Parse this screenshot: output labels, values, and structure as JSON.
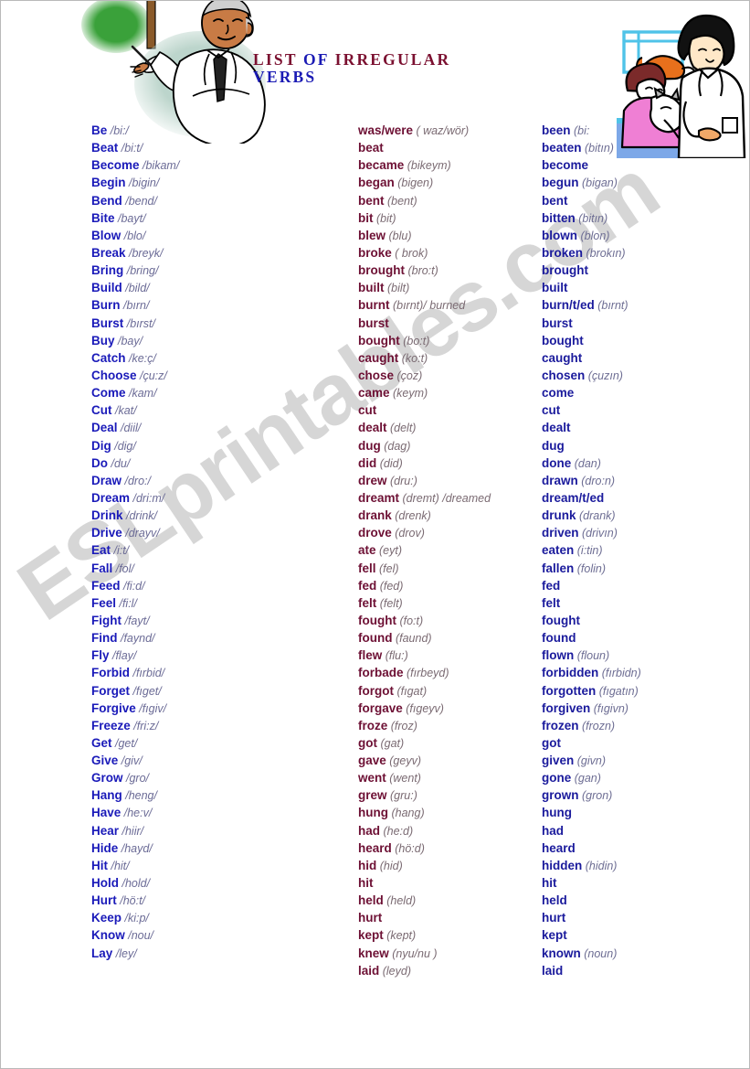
{
  "title": {
    "line1_part1": "LIST ",
    "line1_part2": "OF ",
    "line1_part3": "IRREGULAR",
    "line2": "VERBS"
  },
  "watermark": {
    "text": "ESLprintables.com"
  },
  "colors": {
    "base_word": "#1a1ab9",
    "base_phonetic": "#6b6b96",
    "past_word": "#6d1034",
    "past_phonetic": "#7a6a72",
    "participle_word": "#1a1a9c",
    "participle_phonetic": "#6d6d93",
    "title_red": "#7b1030",
    "title_blue": "#1a1ab4",
    "chalkboard_green": "#3aa13a",
    "border": "#b9b9b9"
  },
  "illustrations": [
    {
      "name": "teacher-pointing-at-chalkboard",
      "description": "Teacher in white coat with pointer at a green chalkboard"
    },
    {
      "name": "veterinarian-with-child-and-pets",
      "description": "Vet in white coat with child holding a cat, dog on table"
    }
  ],
  "columns": {
    "base": [
      {
        "word": "Be",
        "phonetic": "/bi:/"
      },
      {
        "word": "Beat",
        "phonetic": "/bi:t/"
      },
      {
        "word": "Become",
        "phonetic": "/bikam/"
      },
      {
        "word": "Begin",
        "phonetic": "/bigin/"
      },
      {
        "word": "Bend",
        "phonetic": "/bend/"
      },
      {
        "word": "Bite",
        "phonetic": "/bayt/"
      },
      {
        "word": "Blow",
        "phonetic": "/blo/"
      },
      {
        "word": "Break",
        "phonetic": "/breyk/"
      },
      {
        "word": "Bring",
        "phonetic": "/bring/"
      },
      {
        "word": "Build",
        "phonetic": "/bild/"
      },
      {
        "word": "Burn",
        "phonetic": "/bırn/"
      },
      {
        "word": "Burst",
        "phonetic": "/bırst/"
      },
      {
        "word": "Buy",
        "phonetic": "/bay/"
      },
      {
        "word": "Catch",
        "phonetic": "/ke:ç/"
      },
      {
        "word": "Choose",
        "phonetic": "/çu:z/"
      },
      {
        "word": "Come",
        "phonetic": "/kam/"
      },
      {
        "word": "Cut",
        "phonetic": "/kat/"
      },
      {
        "word": "Deal",
        "phonetic": "/diil/"
      },
      {
        "word": "Dig",
        "phonetic": "/dig/"
      },
      {
        "word": "Do",
        "phonetic": "/du/"
      },
      {
        "word": "Draw",
        "phonetic": "/dro:/"
      },
      {
        "word": "Dream",
        "phonetic": "/dri:m/"
      },
      {
        "word": "Drink",
        "phonetic": "/drink/"
      },
      {
        "word": "Drive",
        "phonetic": "/drayv/"
      },
      {
        "word": "Eat",
        "phonetic": "/i:t/"
      },
      {
        "word": "Fall",
        "phonetic": "/fol/"
      },
      {
        "word": "Feed",
        "phonetic": "/fi:d/"
      },
      {
        "word": "Feel",
        "phonetic": "/fi:l/"
      },
      {
        "word": "Fight",
        "phonetic": "/fayt/"
      },
      {
        "word": "Find",
        "phonetic": "/faynd/"
      },
      {
        "word": "Fly",
        "phonetic": "/flay/"
      },
      {
        "word": "Forbid",
        "phonetic": "/fırbid/"
      },
      {
        "word": "Forget",
        "phonetic": "/fıget/"
      },
      {
        "word": "Forgive",
        "phonetic": "/fıgiv/"
      },
      {
        "word": "Freeze",
        "phonetic": "/fri:z/"
      },
      {
        "word": "Get",
        "phonetic": "/get/"
      },
      {
        "word": "Give",
        "phonetic": "/giv/"
      },
      {
        "word": "Grow",
        "phonetic": "/gro/"
      },
      {
        "word": "Hang",
        "phonetic": "/heng/"
      },
      {
        "word": "Have",
        "phonetic": "/he:v/"
      },
      {
        "word": "Hear",
        "phonetic": "/hiir/"
      },
      {
        "word": "Hide",
        "phonetic": "/hayd/"
      },
      {
        "word": "Hit",
        "phonetic": "/hit/"
      },
      {
        "word": "Hold",
        "phonetic": "/hold/"
      },
      {
        "word": "Hurt",
        "phonetic": "/hö:t/"
      },
      {
        "word": "Keep",
        "phonetic": "/ki:p/"
      },
      {
        "word": "Know",
        "phonetic": "/nou/"
      },
      {
        "word": "Lay",
        "phonetic": "/ley/"
      }
    ],
    "past": [
      {
        "word": "was/were",
        "phonetic": "( waz/wör)"
      },
      {
        "word": "beat",
        "phonetic": ""
      },
      {
        "word": "became",
        "phonetic": "(bikeym)"
      },
      {
        "word": "began",
        "phonetic": "(bigen)"
      },
      {
        "word": "bent",
        "phonetic": "(bent)"
      },
      {
        "word": "bit",
        "phonetic": "(bit)"
      },
      {
        "word": "blew",
        "phonetic": "(blu)"
      },
      {
        "word": "broke",
        "phonetic": "( brok)"
      },
      {
        "word": "brought",
        "phonetic": "(bro:t)"
      },
      {
        "word": "built",
        "phonetic": "(bilt)"
      },
      {
        "word": "burnt",
        "phonetic": "(bırnt)/ burned"
      },
      {
        "word": "burst",
        "phonetic": ""
      },
      {
        "word": "bought",
        "phonetic": "(bo:t)"
      },
      {
        "word": "caught",
        "phonetic": "(ko:t)"
      },
      {
        "word": "chose",
        "phonetic": "(çoz)"
      },
      {
        "word": "came",
        "phonetic": "(keym)"
      },
      {
        "word": "cut",
        "phonetic": ""
      },
      {
        "word": "dealt",
        "phonetic": "(delt)"
      },
      {
        "word": "dug",
        "phonetic": "(dag)"
      },
      {
        "word": "did",
        "phonetic": "(did)"
      },
      {
        "word": "drew",
        "phonetic": "(dru:)"
      },
      {
        "word": "dreamt",
        "phonetic": "(dremt) /dreamed"
      },
      {
        "word": "drank",
        "phonetic": "(drenk)"
      },
      {
        "word": "drove",
        "phonetic": "(drov)"
      },
      {
        "word": "ate",
        "phonetic": "(eyt)"
      },
      {
        "word": "fell",
        "phonetic": "(fel)"
      },
      {
        "word": "fed",
        "phonetic": "(fed)"
      },
      {
        "word": "felt",
        "phonetic": "(felt)"
      },
      {
        "word": "fought",
        "phonetic": "(fo:t)"
      },
      {
        "word": "found",
        "phonetic": "(faund)"
      },
      {
        "word": "flew",
        "phonetic": "(flu:)"
      },
      {
        "word": "forbade",
        "phonetic": "(fırbeyd)"
      },
      {
        "word": "forgot",
        "phonetic": "(fıgat)"
      },
      {
        "word": "forgave",
        "phonetic": "(fıgeyv)"
      },
      {
        "word": "froze",
        "phonetic": "(froz)"
      },
      {
        "word": "got",
        "phonetic": "(gat)"
      },
      {
        "word": "gave",
        "phonetic": "(geyv)"
      },
      {
        "word": "went",
        "phonetic": "(went)"
      },
      {
        "word": "grew",
        "phonetic": "(gru:)"
      },
      {
        "word": "hung",
        "phonetic": "(hang)"
      },
      {
        "word": "had",
        "phonetic": "(he:d)"
      },
      {
        "word": "heard",
        "phonetic": "(hö:d)"
      },
      {
        "word": "hid",
        "phonetic": "(hid)"
      },
      {
        "word": "hit",
        "phonetic": ""
      },
      {
        "word": "held",
        "phonetic": "(held)"
      },
      {
        "word": "hurt",
        "phonetic": ""
      },
      {
        "word": "kept",
        "phonetic": "(kept)"
      },
      {
        "word": "knew",
        "phonetic": "(nyu/nu )"
      },
      {
        "word": "laid",
        "phonetic": "(leyd)"
      }
    ],
    "participle": [
      {
        "word": "been",
        "phonetic": "(bi:"
      },
      {
        "word": "beaten",
        "phonetic": "(bitın)"
      },
      {
        "word": "become",
        "phonetic": ""
      },
      {
        "word": "begun",
        "phonetic": "(bigan)"
      },
      {
        "word": "bent",
        "phonetic": ""
      },
      {
        "word": "bitten",
        "phonetic": "(bitın)"
      },
      {
        "word": "blown",
        "phonetic": "(blon)"
      },
      {
        "word": "broken",
        "phonetic": "(brokın)"
      },
      {
        "word": "brought",
        "phonetic": ""
      },
      {
        "word": "built",
        "phonetic": ""
      },
      {
        "word": "burn/t/ed",
        "phonetic": "(bırnt)"
      },
      {
        "word": "burst",
        "phonetic": ""
      },
      {
        "word": "bought",
        "phonetic": ""
      },
      {
        "word": "caught",
        "phonetic": ""
      },
      {
        "word": "chosen",
        "phonetic": "(çuzın)"
      },
      {
        "word": "come",
        "phonetic": ""
      },
      {
        "word": "cut",
        "phonetic": ""
      },
      {
        "word": "dealt",
        "phonetic": ""
      },
      {
        "word": "dug",
        "phonetic": ""
      },
      {
        "word": "done",
        "phonetic": "(dan)"
      },
      {
        "word": "drawn",
        "phonetic": "(dro:n)"
      },
      {
        "word": "dream/t/ed",
        "phonetic": ""
      },
      {
        "word": "drunk",
        "phonetic": "(drank)"
      },
      {
        "word": "driven",
        "phonetic": "(drivın)"
      },
      {
        "word": "eaten",
        "phonetic": "(i:tin)"
      },
      {
        "word": "fallen",
        "phonetic": "(folin)"
      },
      {
        "word": "fed",
        "phonetic": ""
      },
      {
        "word": "felt",
        "phonetic": ""
      },
      {
        "word": "fought",
        "phonetic": ""
      },
      {
        "word": "found",
        "phonetic": ""
      },
      {
        "word": "flown",
        "phonetic": "(floun)"
      },
      {
        "word": "forbidden",
        "phonetic": "(fırbidn)"
      },
      {
        "word": "forgotten",
        "phonetic": "(fıgatın)"
      },
      {
        "word": "forgiven",
        "phonetic": "(fıgivn)"
      },
      {
        "word": "frozen",
        "phonetic": "(frozn)"
      },
      {
        "word": "got",
        "phonetic": ""
      },
      {
        "word": "given",
        "phonetic": "(givn)"
      },
      {
        "word": "gone",
        "phonetic": "(gan)"
      },
      {
        "word": "grown",
        "phonetic": "(gron)"
      },
      {
        "word": "hung",
        "phonetic": ""
      },
      {
        "word": "had",
        "phonetic": ""
      },
      {
        "word": "heard",
        "phonetic": ""
      },
      {
        "word": "hidden",
        "phonetic": "(hidin)"
      },
      {
        "word": "hit",
        "phonetic": ""
      },
      {
        "word": "held",
        "phonetic": ""
      },
      {
        "word": "hurt",
        "phonetic": ""
      },
      {
        "word": "kept",
        "phonetic": ""
      },
      {
        "word": "known",
        "phonetic": "(noun)"
      },
      {
        "word": "laid",
        "phonetic": ""
      }
    ]
  }
}
